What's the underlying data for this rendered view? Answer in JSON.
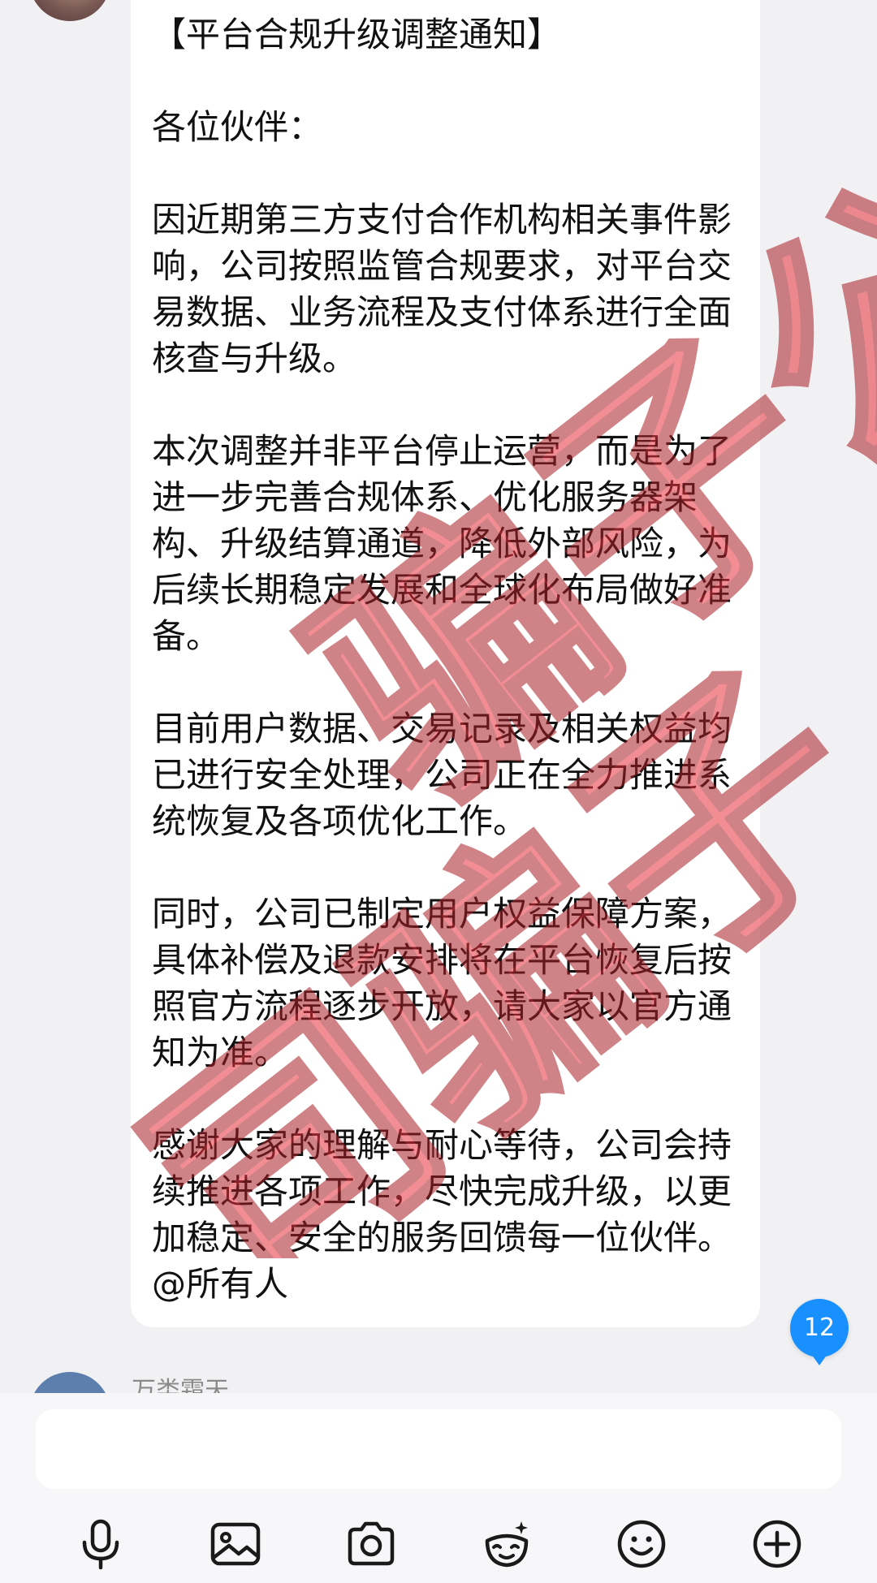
{
  "message": {
    "paragraphs": [
      "【平台合规升级调整通知】",
      "各位伙伴：",
      "因近期第三方支付合作机构相关事件影响，公司按照监管合规要求，对平台交易数据、业务流程及支付体系进行全面核查与升级。",
      "本次调整并非平台停止运营，而是为了进一步完善合规体系、优化服务器架构、升级结算通道，降低外部风险，为后续长期稳定发展和全球化布局做好准备。",
      "目前用户数据、交易记录及相关权益均已进行安全处理，公司正在全力推进系统恢复及各项优化工作。",
      "同时，公司已制定用户权益保障方案，具体补偿及退款安排将在平台恢复后按照官方流程逐步开放，请大家以官方通知为准。",
      "感谢大家的理解与耐心等待，公司会持续推进各项工作，尽快完成升级，以更加稳定、安全的服务回馈每一位伙伴。@所有人"
    ]
  },
  "stamp": {
    "text": "骗子公司骗子",
    "color": "#e8323c"
  },
  "unread_badge": {
    "count": "12",
    "color": "#1890ff"
  },
  "next_message": {
    "sender_name": "万类霜天"
  },
  "input": {
    "value": "",
    "placeholder": ""
  },
  "toolbar": {
    "icons": [
      "microphone-icon",
      "image-icon",
      "camera-icon",
      "sticker-icon",
      "emoji-icon",
      "plus-icon"
    ]
  }
}
